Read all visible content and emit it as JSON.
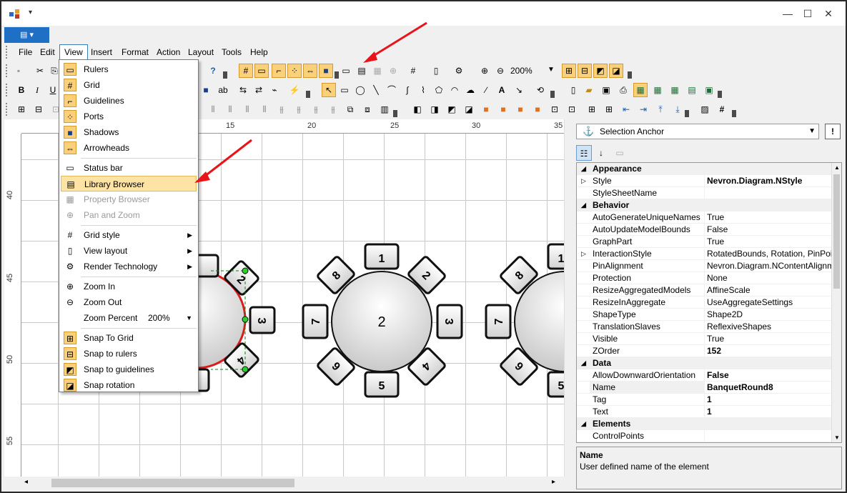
{
  "titlebar": {
    "minimize": "—",
    "maximize": "☐",
    "close": "✕"
  },
  "menubar": {
    "items": [
      "File",
      "Edit",
      "View",
      "Insert",
      "Format",
      "Action",
      "Layout",
      "Tools",
      "Help"
    ]
  },
  "toolbar": {
    "zoom_value": "200%"
  },
  "ruler": {
    "h_ticks": [
      "15",
      "20",
      "25",
      "30",
      "35"
    ],
    "v_ticks": [
      "40",
      "45",
      "50",
      "55"
    ]
  },
  "view_menu": {
    "items": [
      {
        "label": "Rulers",
        "icon": "rulers-icon"
      },
      {
        "label": "Grid",
        "icon": "grid-icon"
      },
      {
        "label": "Guidelines",
        "icon": "guidelines-icon"
      },
      {
        "label": "Ports",
        "icon": "ports-icon"
      },
      {
        "label": "Shadows",
        "icon": "shadows-icon"
      },
      {
        "label": "Arrowheads",
        "icon": "arrowheads-icon"
      },
      {
        "label": "Status bar",
        "icon": "status-bar-icon"
      },
      {
        "label": "Library Browser",
        "icon": "library-browser-icon"
      },
      {
        "label": "Property Browser",
        "icon": "property-browser-icon"
      },
      {
        "label": "Pan and Zoom",
        "icon": "pan-zoom-icon"
      },
      {
        "label": "Grid style",
        "icon": "grid-style-icon"
      },
      {
        "label": "View layout",
        "icon": "view-layout-icon"
      },
      {
        "label": "Render Technology",
        "icon": "render-technology-icon"
      },
      {
        "label": "Zoom In",
        "icon": "zoom-in-icon"
      },
      {
        "label": "Zoom Out",
        "icon": "zoom-out-icon"
      },
      {
        "label": "Zoom Percent",
        "icon": ""
      },
      {
        "label": "Snap To Grid",
        "icon": "snap-to-grid-icon"
      },
      {
        "label": "Snap to rulers",
        "icon": "snap-to-rulers-icon"
      },
      {
        "label": "Snap to guidelines",
        "icon": "snap-to-guidelines-icon"
      },
      {
        "label": "Snap rotation",
        "icon": "snap-rotation-icon"
      }
    ],
    "zoom_percent_value": "200%"
  },
  "diagram": {
    "table_center_label": "2",
    "seats": [
      "1",
      "2",
      "3",
      "4",
      "5",
      "6",
      "7",
      "8"
    ],
    "left_table_seats": [
      "2",
      "3",
      "4"
    ],
    "right_table_seats": [
      "1",
      "7",
      "8",
      "6",
      "5"
    ]
  },
  "properties": {
    "selector": "Selection Anchor",
    "categories": [
      {
        "name": "Appearance",
        "rows": [
          {
            "name": "Style",
            "value": "Nevron.Diagram.NStyle",
            "bold": true,
            "expand": true
          },
          {
            "name": "StyleSheetName",
            "value": "",
            "bold": false
          }
        ]
      },
      {
        "name": "Behavior",
        "rows": [
          {
            "name": "AutoGenerateUniqueNames",
            "value": "True",
            "bold": false
          },
          {
            "name": "AutoUpdateModelBounds",
            "value": "False",
            "bold": false
          },
          {
            "name": "GraphPart",
            "value": "True",
            "bold": false
          },
          {
            "name": "InteractionStyle",
            "value": "RotatedBounds, Rotation, PinPoint, S",
            "bold": false,
            "expand": true
          },
          {
            "name": "PinAlignment",
            "value": "Nevron.Diagram.NContentAlignment",
            "bold": false
          },
          {
            "name": "Protection",
            "value": "None",
            "bold": false
          },
          {
            "name": "ResizeAggregatedModels",
            "value": "AffineScale",
            "bold": false
          },
          {
            "name": "ResizeInAggregate",
            "value": "UseAggregateSettings",
            "bold": false
          },
          {
            "name": "ShapeType",
            "value": "Shape2D",
            "bold": false
          },
          {
            "name": "TranslationSlaves",
            "value": "ReflexiveShapes",
            "bold": false
          },
          {
            "name": "Visible",
            "value": "True",
            "bold": false
          },
          {
            "name": "ZOrder",
            "value": "152",
            "bold": true
          }
        ]
      },
      {
        "name": "Data",
        "rows": [
          {
            "name": "AllowDownwardOrientation",
            "value": "False",
            "bold": true
          },
          {
            "name": "Name",
            "value": "BanquetRound8",
            "bold": true,
            "selected": true
          },
          {
            "name": "Tag",
            "value": "1",
            "bold": true
          },
          {
            "name": "Text",
            "value": "1",
            "bold": true
          }
        ]
      },
      {
        "name": "Elements",
        "rows": [
          {
            "name": "ControlPoints",
            "value": "",
            "bold": false
          }
        ]
      }
    ],
    "description_title": "Name",
    "description_text": "User defined name of the element"
  }
}
